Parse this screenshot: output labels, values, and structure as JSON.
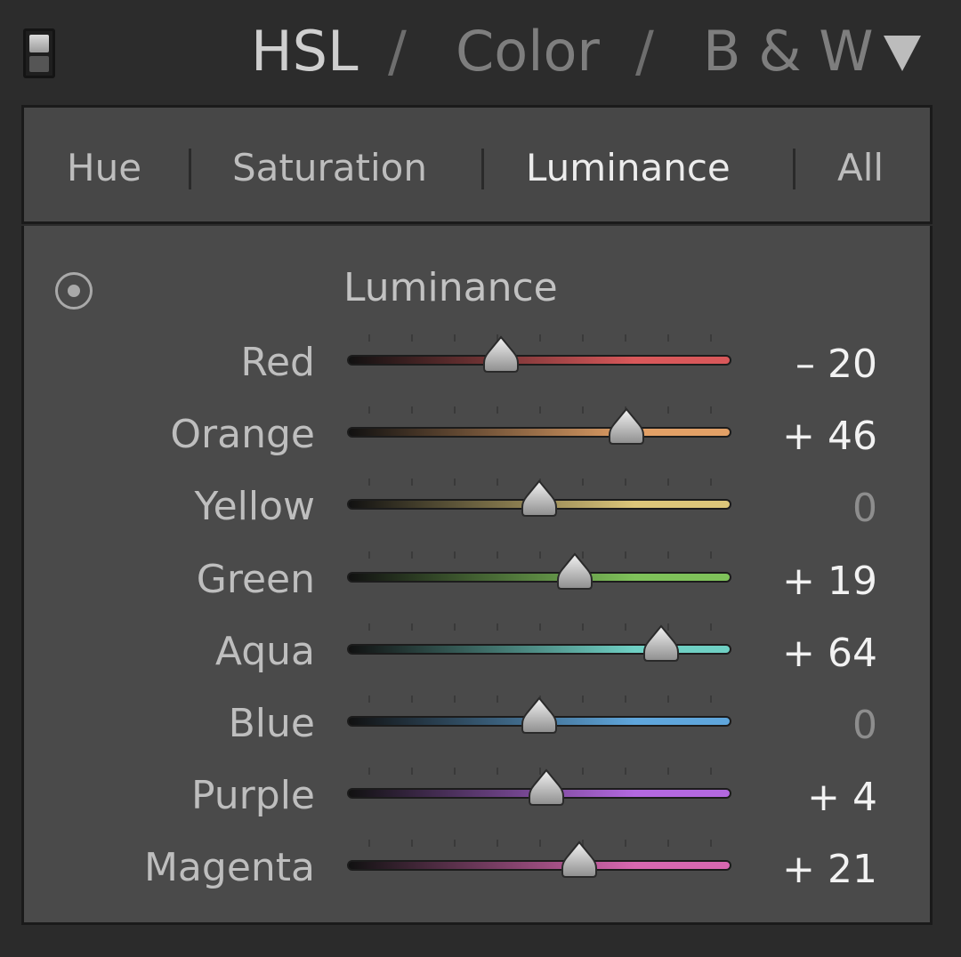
{
  "header": {
    "hsl_label": "HSL",
    "separator": "/",
    "color_label": "Color",
    "bw_label": "B & W"
  },
  "tabs": [
    {
      "label": "Hue",
      "active": false
    },
    {
      "label": "Saturation",
      "active": false
    },
    {
      "label": "Luminance",
      "active": true
    },
    {
      "label": "All",
      "active": false
    }
  ],
  "section": {
    "title": "Luminance"
  },
  "slider_range": [
    -100,
    100
  ],
  "sliders": [
    {
      "label": "Red",
      "value": -20,
      "display": "– 20",
      "color": "#d9585a"
    },
    {
      "label": "Orange",
      "value": 46,
      "display": "+ 46",
      "color": "#e2a066"
    },
    {
      "label": "Yellow",
      "value": 0,
      "display": "0",
      "color": "#dcc67a"
    },
    {
      "label": "Green",
      "value": 19,
      "display": "+ 19",
      "color": "#7fc25a"
    },
    {
      "label": "Aqua",
      "value": 64,
      "display": "+ 64",
      "color": "#6fd0c4"
    },
    {
      "label": "Blue",
      "value": 0,
      "display": "0",
      "color": "#5fa6dc"
    },
    {
      "label": "Purple",
      "value": 4,
      "display": "+ 4",
      "color": "#b368e0"
    },
    {
      "label": "Magenta",
      "value": 21,
      "display": "+ 21",
      "color": "#d867b0"
    }
  ],
  "icons": {
    "panel_switch": "panel-switch-icon",
    "collapse": "triangle-down-icon",
    "target": "targeted-adjustment-icon",
    "thumb": "slider-thumb-icon"
  }
}
